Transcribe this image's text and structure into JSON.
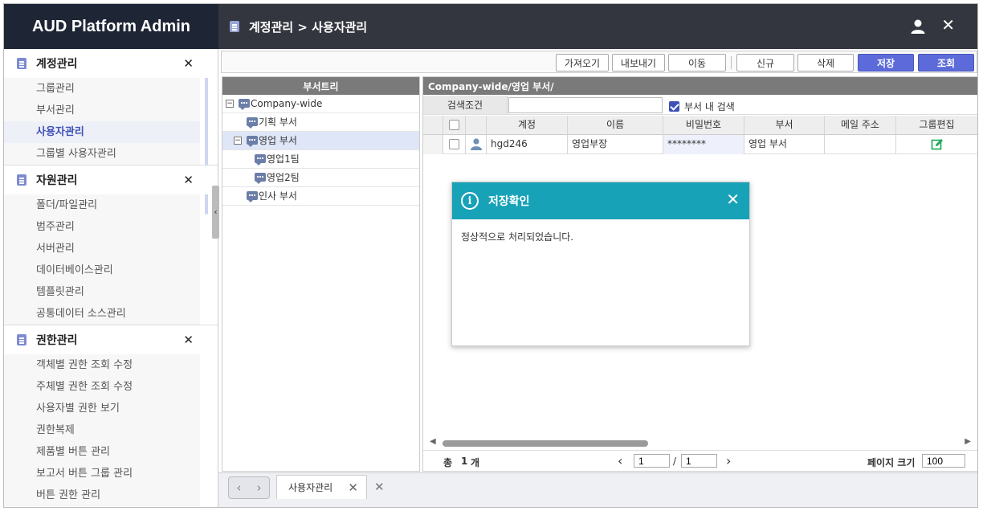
{
  "app": {
    "title": "AUD Platform Admin"
  },
  "header": {
    "breadcrumb": "계정관리 > 사용자관리",
    "user_icon": "user-icon",
    "close_icon": "close-icon"
  },
  "sidebar": {
    "groups": [
      {
        "title": "계정관리",
        "items": [
          "그룹관리",
          "부서관리",
          "사용자관리",
          "그룹별 사용자관리"
        ],
        "active": "사용자관리"
      },
      {
        "title": "자원관리",
        "items": [
          "폴더/파일관리",
          "범주관리",
          "서버관리",
          "데이터베이스관리",
          "템플릿관리",
          "공통데이터 소스관리"
        ]
      },
      {
        "title": "권한관리",
        "items": [
          "객체별 권한 조회 수정",
          "주체별 권한 조회 수정",
          "사용자별 권한 보기",
          "권한복제",
          "제품별 버튼 관리",
          "보고서 버튼 그룹 관리",
          "버튼 권한 관리"
        ]
      }
    ],
    "close_symbol": "✕"
  },
  "toolbar": {
    "import": "가져오기",
    "export": "내보내기",
    "move": "이동",
    "new": "신규",
    "delete": "삭제",
    "save": "저장",
    "search": "조회"
  },
  "tree": {
    "title": "부서트리",
    "nodes": [
      {
        "label": "Company-wide",
        "expanded": true
      },
      {
        "label": "기획 부서"
      },
      {
        "label": "영업 부서",
        "expanded": true
      },
      {
        "label": "영업1팀"
      },
      {
        "label": "영업2팀"
      },
      {
        "label": "인사 부서"
      }
    ]
  },
  "grid": {
    "path": "Company-wide/영업 부서/",
    "search_label": "검색조건",
    "search_value": "",
    "search_within_label": "부서 내 검색",
    "search_within_checked": true,
    "columns": [
      "계정",
      "이름",
      "비밀번호",
      "부서",
      "메일 주소",
      "그룹편집"
    ],
    "rows": [
      {
        "account": "hgd246",
        "name": "영업부장",
        "password": "********",
        "dept": "영업 부서",
        "email": ""
      }
    ],
    "pager": {
      "total_label": "총",
      "total_count": "1",
      "unit": "개",
      "page": "1",
      "sep": "/",
      "pages": "1",
      "size_label": "페이지 크기",
      "size": "100"
    }
  },
  "dialog": {
    "title": "저장확인",
    "message": "정상적으로 처리되었습니다."
  },
  "bottom": {
    "tab_label": "사용자관리",
    "close_symbol": "✕",
    "prev": "‹",
    "next": "›"
  }
}
